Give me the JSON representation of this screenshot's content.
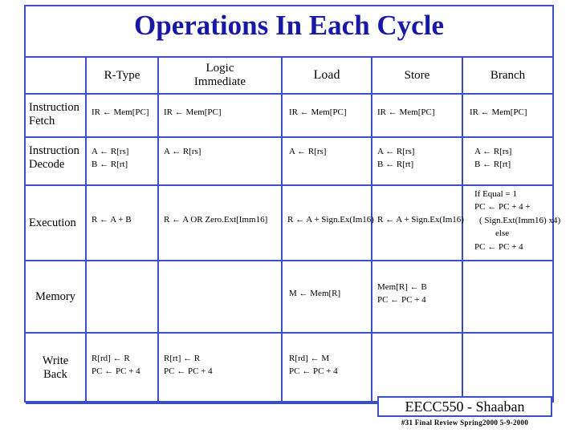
{
  "title": "Operations In Each Cycle",
  "table": {
    "columns": [
      {
        "label": ""
      },
      {
        "label": "R-Type"
      },
      {
        "label": "Logic\nImmediate"
      },
      {
        "label": "Load"
      },
      {
        "label": "Store"
      },
      {
        "label": "Branch"
      }
    ],
    "column_labels": {
      "blank": "",
      "rtype": "R-Type",
      "logic_immediate_line1": "Logic",
      "logic_immediate_line2": "Immediate",
      "load": "Load",
      "store": "Store",
      "branch": "Branch"
    },
    "rows": [
      {
        "label_line1": "Instruction",
        "label_line2": "Fetch",
        "rtype": [
          "IR ←   Mem[PC]"
        ],
        "logic_immediate": [
          "IR ←      Mem[PC]"
        ],
        "load": [
          "IR ←   Mem[PC]"
        ],
        "store": [
          "IR ←   Mem[PC]"
        ],
        "branch": [
          "IR ←   Mem[PC]"
        ]
      },
      {
        "label_line1": "Instruction",
        "label_line2": "Decode",
        "rtype": [
          "A ←    R[rs]",
          "B ←    R[rt]"
        ],
        "logic_immediate": [
          "A ←    R[rs]"
        ],
        "load": [
          "A ←   R[rs]"
        ],
        "store": [
          "A ←   R[rs]",
          "B ←   R[rt]"
        ],
        "branch": [
          "A ←     R[rs]",
          "B ←     R[rt]"
        ]
      },
      {
        "label_line1": "Execution",
        "label_line2": "",
        "rtype": [
          "R ←  A + B"
        ],
        "logic_immediate": [
          "R ←   A OR  Zero.Ext[Imm16]"
        ],
        "load": [
          "R ← A + Sign.Ex(Im16)"
        ],
        "store": [
          "R ←   A + Sign.Ex(Im16)"
        ],
        "branch": [
          "If  Equal = 1",
          "PC ←   PC + 4 +",
          "( Sign.Ext(Imm16) x4)",
          "else",
          "PC ←    PC + 4"
        ]
      },
      {
        "label_line1": "Memory",
        "label_line2": "",
        "rtype": [],
        "logic_immediate": [],
        "load": [
          "M ←    Mem[R]"
        ],
        "store": [
          "Mem[R]   ←     B",
          "PC  ←    PC + 4"
        ],
        "branch": []
      },
      {
        "label_line1": "Write",
        "label_line2": "Back",
        "rtype": [
          "R[rd] ←   R",
          "PC ←   PC + 4"
        ],
        "logic_immediate": [
          "R[rt] ←  R",
          "PC ←  PC + 4"
        ],
        "load": [
          "R[rd] ←    M",
          "PC ←   PC + 4"
        ],
        "store": [],
        "branch": []
      }
    ]
  },
  "footer": {
    "banner": "EECC550 - Shaaban",
    "sub": "#31   Final Review   Spring2000    5-9-2000"
  },
  "colors": {
    "title": "#1818a8",
    "rule": "#3b4fc4",
    "text": "#000000",
    "background": "#ffffff"
  }
}
